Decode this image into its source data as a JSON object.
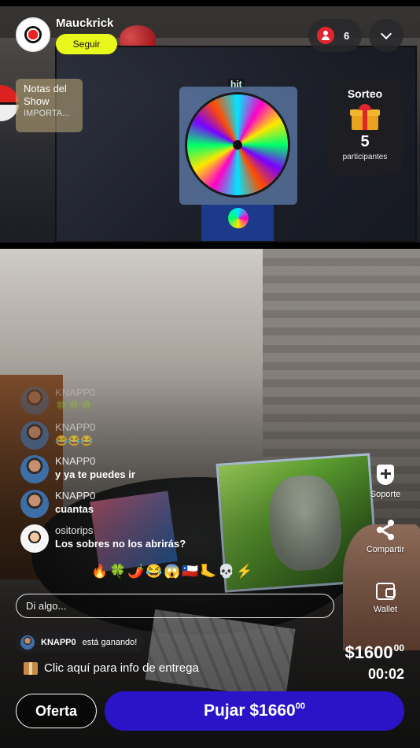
{
  "host": {
    "name": "Mauckrick",
    "follow_label": "Seguir"
  },
  "viewers": {
    "count": "6",
    "icon": "person-icon",
    "color": "#e2242e"
  },
  "collapse": {
    "icon": "chevron-down-icon"
  },
  "notes": {
    "title": "Notas del Show",
    "subtitle": "IMPORTA..."
  },
  "stream_overlay": {
    "wheel_logo": "hit"
  },
  "raffle": {
    "title": "Sorteo",
    "icon": "gift-icon",
    "count": "5",
    "label": "participantes"
  },
  "chat": {
    "messages": [
      {
        "user": "KNAPP0",
        "text": "🍀🍀🍀"
      },
      {
        "user": "KNAPP0",
        "text": "😂😂😂"
      },
      {
        "user": "KNAPP0",
        "text": "y ya te puedes ir"
      },
      {
        "user": "KNAPP0",
        "text": "cuantas"
      },
      {
        "user": "ositorips",
        "text": "Los sobres no los abrirás?"
      }
    ],
    "reactions": [
      "🔥",
      "🍀",
      "🌶️",
      "😂",
      "😱",
      "🇨🇱",
      "🦶",
      "💀",
      "⚡"
    ],
    "input_placeholder": "Di algo..."
  },
  "side_actions": {
    "support": {
      "label": "Soporte",
      "icon": "shield-plus-icon"
    },
    "share": {
      "label": "Compartir",
      "icon": "share-icon"
    },
    "wallet": {
      "label": "Wallet",
      "icon": "wallet-icon"
    }
  },
  "auction": {
    "winner_user": "KNAPP0",
    "winner_text": "está ganando!",
    "delivery_text": "Clic aquí para info de entrega",
    "delivery_icon": "package-icon",
    "price_main": "$1600",
    "price_cents": "00",
    "timer": "00:02"
  },
  "buttons": {
    "offer_label": "Oferta",
    "bid_label": "Pujar $1660",
    "bid_cents": "00",
    "bid_color": "#2b14c8",
    "follow_color": "#e9f81c"
  }
}
